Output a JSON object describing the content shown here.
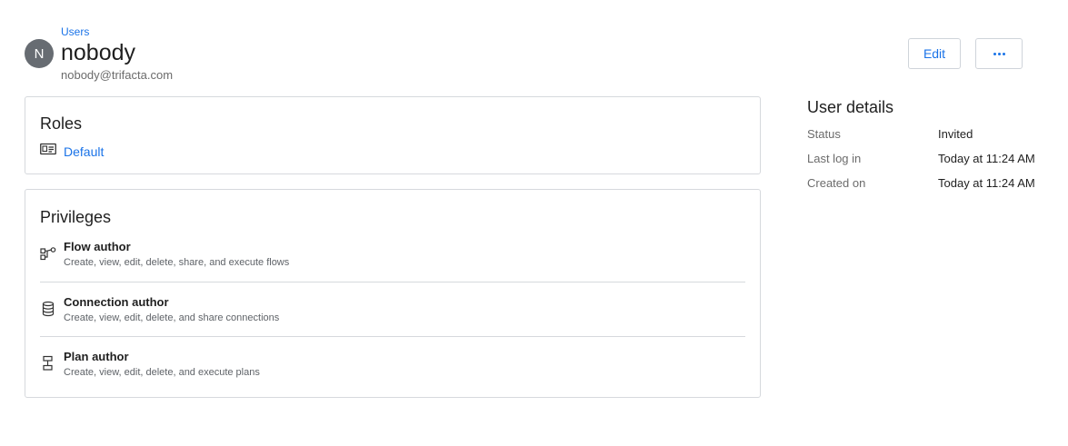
{
  "header": {
    "breadcrumb": "Users",
    "avatar_initial": "N",
    "name": "nobody",
    "email": "nobody@trifacta.com",
    "edit_label": "Edit",
    "more_icon": "more-horizontal-icon"
  },
  "roles": {
    "title": "Roles",
    "items": [
      {
        "icon": "id-card-icon",
        "label": "Default"
      }
    ]
  },
  "privileges": {
    "title": "Privileges",
    "items": [
      {
        "icon": "flow-icon",
        "name": "Flow author",
        "description": "Create, view, edit, delete, share, and execute flows"
      },
      {
        "icon": "database-icon",
        "name": "Connection author",
        "description": "Create, view, edit, delete, and share connections"
      },
      {
        "icon": "plan-icon",
        "name": "Plan author",
        "description": "Create, view, edit, delete, and execute plans"
      }
    ]
  },
  "user_details": {
    "title": "User details",
    "rows": [
      {
        "label": "Status",
        "value": "Invited"
      },
      {
        "label": "Last log in",
        "value": "Today at 11:24 AM"
      },
      {
        "label": "Created on",
        "value": "Today at 11:24 AM"
      }
    ]
  },
  "colors": {
    "accent": "#1a73e8",
    "avatar_bg": "#676c72",
    "border": "#d6d9dd"
  }
}
